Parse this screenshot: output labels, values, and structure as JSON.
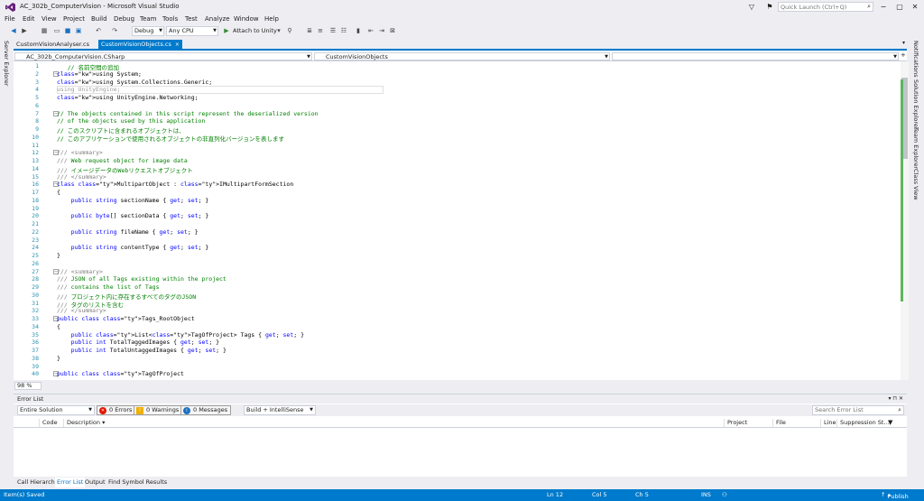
{
  "window": {
    "title": "AC_302b_ComputerVision - Microsoft Visual Studio",
    "quick_launch_placeholder": "Quick Launch (Ctrl+Q)"
  },
  "menu": [
    "File",
    "Edit",
    "View",
    "Project",
    "Build",
    "Debug",
    "Team",
    "Tools",
    "Test",
    "Analyze",
    "Window",
    "Help"
  ],
  "toolbar": {
    "config": "Debug",
    "platform": "Any CPU",
    "attach": "Attach to Unity"
  },
  "left_panel": {
    "server_explorer": "Server Explorer"
  },
  "right_panel": [
    "Notifications",
    "Solution Explorer",
    "Team Explorer",
    "Class View"
  ],
  "tabs": [
    {
      "label": "CustomVisionAnalyser.cs",
      "close": ""
    },
    {
      "label": "CustomVisionObjects.cs",
      "close": "×"
    }
  ],
  "nav": {
    "project": "AC_302b_ComputerVision.CSharp",
    "class": "CustomVisionObjects",
    "member": ""
  },
  "code_lines": [
    {
      "n": "1",
      "t": "   // 名前空間の追加"
    },
    {
      "n": "2",
      "t": "using System;"
    },
    {
      "n": "3",
      "t": "using System.Collections.Generic;"
    },
    {
      "n": "4",
      "t": "using UnityEngine;"
    },
    {
      "n": "5",
      "t": "using UnityEngine.Networking;"
    },
    {
      "n": "6",
      "t": ""
    },
    {
      "n": "7",
      "t": "// The objects contained in this script represent the deserialized version"
    },
    {
      "n": "8",
      "t": "// of the objects used by this application"
    },
    {
      "n": "9",
      "t": "// このスクリプトに含まれるオブジェクトは、"
    },
    {
      "n": "10",
      "t": "// このアプリケーションで使用されるオブジェクトの非直列化バージョンを表します"
    },
    {
      "n": "11",
      "t": ""
    },
    {
      "n": "12",
      "t": "/// <summary>"
    },
    {
      "n": "13",
      "t": "/// Web request object for image data"
    },
    {
      "n": "14",
      "t": "/// イメージデータのWebリクエストオブジェクト"
    },
    {
      "n": "15",
      "t": "/// </summary>"
    },
    {
      "n": "16",
      "t": "class MultipartObject : IMultipartFormSection"
    },
    {
      "n": "17",
      "t": "{"
    },
    {
      "n": "18",
      "t": "    public string sectionName { get; set; }"
    },
    {
      "n": "19",
      "t": ""
    },
    {
      "n": "20",
      "t": "    public byte[] sectionData { get; set; }"
    },
    {
      "n": "21",
      "t": ""
    },
    {
      "n": "22",
      "t": "    public string fileName { get; set; }"
    },
    {
      "n": "23",
      "t": ""
    },
    {
      "n": "24",
      "t": "    public string contentType { get; set; }"
    },
    {
      "n": "25",
      "t": "}"
    },
    {
      "n": "26",
      "t": ""
    },
    {
      "n": "27",
      "t": "/// <summary>"
    },
    {
      "n": "28",
      "t": "/// JSON of all Tags existing within the project"
    },
    {
      "n": "29",
      "t": "/// contains the list of Tags"
    },
    {
      "n": "30",
      "t": "/// プロジェクト内に存在するすべてのタグのJSON"
    },
    {
      "n": "31",
      "t": "/// タグのリストを含む"
    },
    {
      "n": "32",
      "t": "/// </summary>"
    },
    {
      "n": "33",
      "t": "public class Tags_RootObject"
    },
    {
      "n": "34",
      "t": "{"
    },
    {
      "n": "35",
      "t": "    public List<TagOfProject> Tags { get; set; }"
    },
    {
      "n": "36",
      "t": "    public int TotalTaggedImages { get; set; }"
    },
    {
      "n": "37",
      "t": "    public int TotalUntaggedImages { get; set; }"
    },
    {
      "n": "38",
      "t": "}"
    },
    {
      "n": "39",
      "t": ""
    },
    {
      "n": "40",
      "t": "public class TagOfProject"
    }
  ],
  "zoom": "98 %",
  "error_list": {
    "title": "Error List",
    "scope": "Entire Solution",
    "errors": "0 Errors",
    "warnings": "0 Warnings",
    "messages": "0 Messages",
    "build_filter": "Build + IntelliSense",
    "search_placeholder": "Search Error List",
    "columns": [
      "Code",
      "Description",
      "Project",
      "File",
      "Line",
      "Suppression St..."
    ]
  },
  "bottom_tabs": [
    "Call Hierarchy",
    "Error List",
    "Output",
    "Find Symbol Results"
  ],
  "status": {
    "message": "Item(s) Saved",
    "ln": "Ln 12",
    "col": "Col 5",
    "ch": "Ch 5",
    "ins": "INS",
    "publish": "Publish"
  },
  "colors": {
    "accent": "#007acc",
    "keyword": "#0000ff",
    "comment": "#008000",
    "type": "#2b91af"
  }
}
